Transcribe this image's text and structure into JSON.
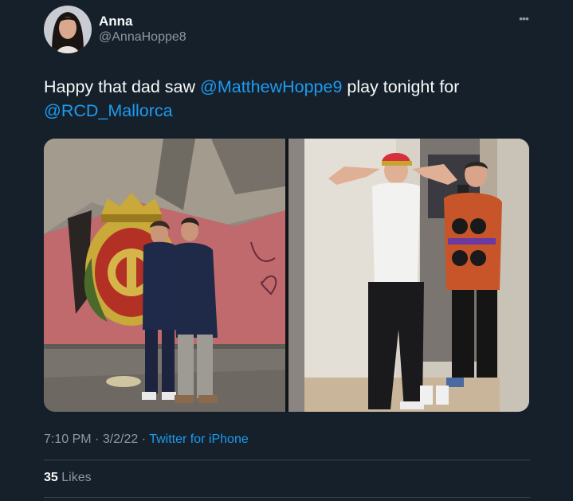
{
  "author": {
    "name": "Anna",
    "handle": "@AnnaHoppe8"
  },
  "tweet": {
    "text_before": "Happy that dad saw ",
    "mention_1": "@MatthewHoppe9",
    "text_middle": " play tonight for ",
    "mention_2": "@RCD_Mallorca"
  },
  "meta": {
    "time": "7:10 PM",
    "separator_1": " · ",
    "date": "3/2/22",
    "separator_2": " · ",
    "source": "Twitter for iPhone"
  },
  "stats": {
    "likes_count": "35",
    "likes_label": "Likes"
  },
  "icons": {
    "more": "more-horizontal-icon"
  },
  "colors": {
    "background": "#15202b",
    "link": "#1d9bf0",
    "secondary_text": "#8b98a5",
    "divider": "#38444d"
  }
}
